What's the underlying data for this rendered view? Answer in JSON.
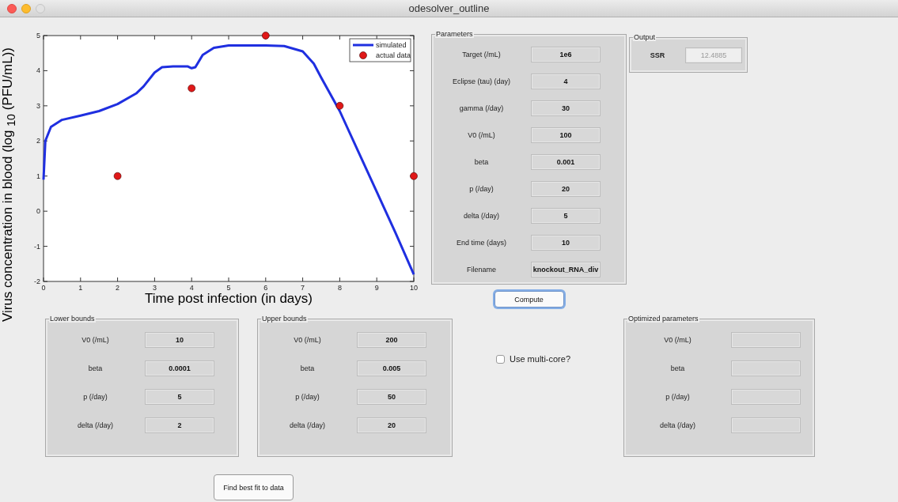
{
  "window": {
    "title": "odesolver_outline"
  },
  "chart": {
    "chart_data": {
      "type": "line",
      "xlabel": "Time post infection (in days)",
      "ylabel": "Virus concentration in blood (log $_{10}$ (PFU/mL))",
      "x": [
        0,
        0.05,
        0.2,
        0.5,
        1,
        1.5,
        2,
        2.5,
        2.7,
        3,
        3.2,
        3.5,
        3.9,
        4,
        4.1,
        4.3,
        4.6,
        5,
        6,
        6.5,
        7,
        7.3,
        7.5,
        8,
        8.5,
        9,
        9.5,
        10
      ],
      "xlim": [
        0,
        10
      ],
      "ylim": [
        -2,
        5
      ],
      "xticks": [
        0,
        1,
        2,
        3,
        4,
        5,
        6,
        7,
        8,
        9,
        10
      ],
      "yticks": [
        -2,
        -1,
        0,
        1,
        2,
        3,
        4,
        5
      ],
      "legend": true,
      "series": [
        {
          "name": "simulated",
          "type": "line",
          "color": "#1f2fe0",
          "values": [
            0.9,
            2.0,
            2.4,
            2.6,
            2.72,
            2.85,
            3.05,
            3.35,
            3.55,
            3.95,
            4.1,
            4.12,
            4.12,
            4.07,
            4.1,
            4.45,
            4.65,
            4.72,
            4.72,
            4.7,
            4.55,
            4.2,
            3.8,
            2.85,
            1.7,
            0.55,
            -0.6,
            -1.8
          ]
        },
        {
          "name": "actual data",
          "type": "scatter",
          "color": "#e01818",
          "values": [
            null,
            null,
            null,
            null,
            null,
            null,
            1,
            null,
            null,
            null,
            null,
            null,
            null,
            3.5,
            null,
            null,
            null,
            null,
            5,
            null,
            null,
            null,
            null,
            3,
            null,
            null,
            null,
            1
          ]
        }
      ]
    }
  },
  "parameters": {
    "title": "Parameters",
    "fields": [
      {
        "label": "Target (/mL)",
        "value": "1e6"
      },
      {
        "label": "Eclipse (tau) (day)",
        "value": "4"
      },
      {
        "label": "gamma (/day)",
        "value": "30"
      },
      {
        "label": "V0 (/mL)",
        "value": "100"
      },
      {
        "label": "beta",
        "value": "0.001"
      },
      {
        "label": "p (/day)",
        "value": "20"
      },
      {
        "label": "delta (/day)",
        "value": "5"
      },
      {
        "label": "End time (days)",
        "value": "10"
      },
      {
        "label": "Filename",
        "value": "knockout_RNA_div"
      }
    ]
  },
  "compute_button": {
    "label": "Compute",
    "focused": true
  },
  "output": {
    "title": "Output",
    "fields": [
      {
        "label": "SSR",
        "value": "12.4885",
        "disabled": true
      }
    ]
  },
  "lower_bounds": {
    "title": "Lower bounds",
    "fields": [
      {
        "label": "V0 (/mL)",
        "value": "10"
      },
      {
        "label": "beta",
        "value": "0.0001"
      },
      {
        "label": "p (/day)",
        "value": "5"
      },
      {
        "label": "delta (/day)",
        "value": "2"
      }
    ]
  },
  "upper_bounds": {
    "title": "Upper bounds",
    "fields": [
      {
        "label": "V0 (/mL)",
        "value": "200"
      },
      {
        "label": "beta",
        "value": "0.005"
      },
      {
        "label": "p (/day)",
        "value": "50"
      },
      {
        "label": "delta (/day)",
        "value": "20"
      }
    ]
  },
  "multicore": {
    "label": "Use multi-core?",
    "checked": false
  },
  "optimized": {
    "title": "Optimized parameters",
    "fields": [
      {
        "label": "V0 (/mL)"
      },
      {
        "label": "beta"
      },
      {
        "label": "p (/day)"
      },
      {
        "label": "delta (/day)"
      }
    ]
  },
  "fit_button": {
    "label": "Find best fit to data",
    "focused": false
  }
}
